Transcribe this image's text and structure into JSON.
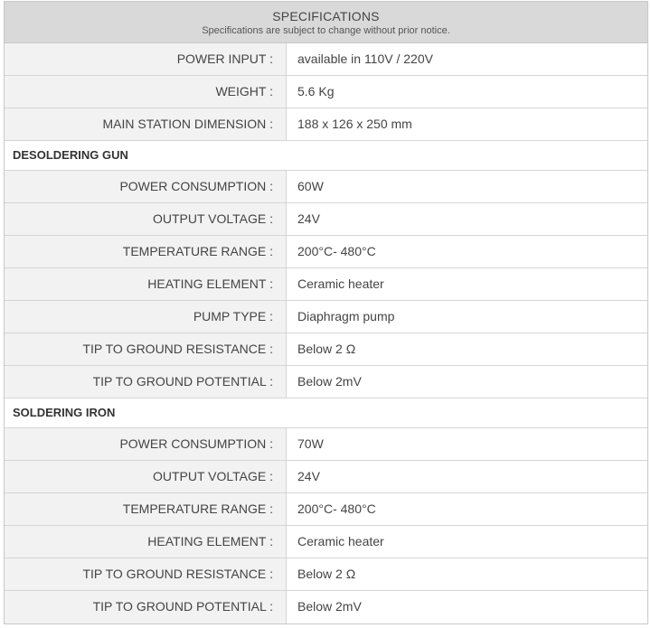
{
  "header": {
    "title": "SPECIFICATIONS",
    "subtitle": "Specifications are subject to change without prior notice."
  },
  "general": [
    {
      "label": "POWER INPUT :",
      "value": "available in 110V / 220V"
    },
    {
      "label": "WEIGHT :",
      "value": "5.6 Kg"
    },
    {
      "label": "MAIN STATION DIMENSION :",
      "value": "188 x 126 x 250 mm"
    }
  ],
  "desoldering_gun": {
    "title": "DESOLDERING GUN",
    "rows": [
      {
        "label": "POWER CONSUMPTION :",
        "value": "60W"
      },
      {
        "label": "OUTPUT VOLTAGE :",
        "value": "24V"
      },
      {
        "label": "TEMPERATURE RANGE :",
        "value": "200°C- 480°C"
      },
      {
        "label": "HEATING ELEMENT :",
        "value": "Ceramic heater"
      },
      {
        "label": "PUMP TYPE :",
        "value": "Diaphragm pump"
      },
      {
        "label": "TIP TO GROUND RESISTANCE :",
        "value": "Below 2 Ω"
      },
      {
        "label": "TIP TO GROUND POTENTIAL :",
        "value": "Below 2mV"
      }
    ]
  },
  "soldering_iron": {
    "title": "SOLDERING IRON",
    "rows": [
      {
        "label": "POWER CONSUMPTION :",
        "value": "70W"
      },
      {
        "label": "OUTPUT VOLTAGE :",
        "value": "24V"
      },
      {
        "label": "TEMPERATURE RANGE :",
        "value": "200°C- 480°C"
      },
      {
        "label": "HEATING ELEMENT :",
        "value": "Ceramic heater"
      },
      {
        "label": "TIP TO GROUND RESISTANCE :",
        "value": "Below 2 Ω"
      },
      {
        "label": "TIP TO GROUND POTENTIAL :",
        "value": "Below 2mV"
      }
    ]
  }
}
